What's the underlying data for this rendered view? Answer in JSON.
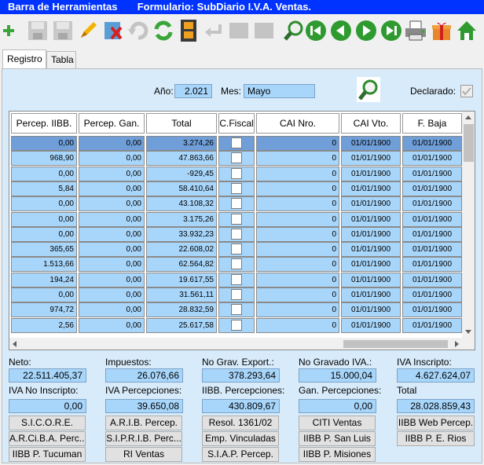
{
  "window": {
    "title": "Barra de Herramientas       Formulario: SubDiario I.V.A. Ventas."
  },
  "toolbar": {
    "icons": [
      "add-icon",
      "save-disabled-icon",
      "save-disabled-icon",
      "edit-icon",
      "delete-icon",
      "undo-disabled-icon",
      "refresh-icon",
      "film-icon",
      "return-disabled-icon",
      "disabled-icon",
      "disabled-icon",
      "search-icon",
      "first-icon",
      "previous-icon",
      "next-icon",
      "last-icon",
      "printer-icon",
      "gift-icon",
      "home-icon"
    ]
  },
  "tabs": [
    {
      "label": "Registro"
    },
    {
      "label": "Tabla"
    }
  ],
  "filter": {
    "anio_label": "Año:",
    "anio_value": "2.021",
    "mes_label": "Mes:",
    "mes_value": "Mayo",
    "declarado_label": "Declarado:"
  },
  "grid": {
    "columns": [
      "Percep. IIBB.",
      "Percep. Gan.",
      "Total",
      "C.Fiscal",
      "CAI Nro.",
      "CAI Vto.",
      "F. Baja"
    ],
    "rows": [
      {
        "iibb": "0,00",
        "gan": "0,00",
        "total": "3.274,26",
        "cai": "0",
        "vto": "01/01/1900",
        "baja": "01/01/1900"
      },
      {
        "iibb": "968,90",
        "gan": "0,00",
        "total": "47.863,66",
        "cai": "0",
        "vto": "01/01/1900",
        "baja": "01/01/1900"
      },
      {
        "iibb": "0,00",
        "gan": "0,00",
        "total": "-929,45",
        "cai": "0",
        "vto": "01/01/1900",
        "baja": "01/01/1900"
      },
      {
        "iibb": "5,84",
        "gan": "0,00",
        "total": "58.410,64",
        "cai": "0",
        "vto": "01/01/1900",
        "baja": "01/01/1900"
      },
      {
        "iibb": "0,00",
        "gan": "0,00",
        "total": "43.108,32",
        "cai": "0",
        "vto": "01/01/1900",
        "baja": "01/01/1900"
      },
      {
        "iibb": "0,00",
        "gan": "0,00",
        "total": "3.175,26",
        "cai": "0",
        "vto": "01/01/1900",
        "baja": "01/01/1900"
      },
      {
        "iibb": "0,00",
        "gan": "0,00",
        "total": "33.932,23",
        "cai": "0",
        "vto": "01/01/1900",
        "baja": "01/01/1900"
      },
      {
        "iibb": "365,65",
        "gan": "0,00",
        "total": "22.608,02",
        "cai": "0",
        "vto": "01/01/1900",
        "baja": "01/01/1900"
      },
      {
        "iibb": "1.513,66",
        "gan": "0,00",
        "total": "62.564,82",
        "cai": "0",
        "vto": "01/01/1900",
        "baja": "01/01/1900"
      },
      {
        "iibb": "194,24",
        "gan": "0,00",
        "total": "19.617,55",
        "cai": "0",
        "vto": "01/01/1900",
        "baja": "01/01/1900"
      },
      {
        "iibb": "0,00",
        "gan": "0,00",
        "total": "31.561,11",
        "cai": "0",
        "vto": "01/01/1900",
        "baja": "01/01/1900"
      },
      {
        "iibb": "974,72",
        "gan": "0,00",
        "total": "28.832,59",
        "cai": "0",
        "vto": "01/01/1900",
        "baja": "01/01/1900"
      },
      {
        "iibb": "2,56",
        "gan": "0,00",
        "total": "25.617,58",
        "cai": "0",
        "vto": "01/01/1900",
        "baja": "01/01/1900"
      }
    ]
  },
  "totals": {
    "neto": {
      "label": "Neto:",
      "value": "22.511.405,37"
    },
    "impuestos": {
      "label": "Impuestos:",
      "value": "26.076,66"
    },
    "no_grav_export": {
      "label": "No Grav. Export.:",
      "value": "378.293,64"
    },
    "no_gravado_iva": {
      "label": "No Gravado IVA.:",
      "value": "15.000,04"
    },
    "iva_inscripto": {
      "label": "IVA Inscripto:",
      "value": "4.627.624,07"
    },
    "iva_no_inscripto": {
      "label": "IVA No Inscripto:",
      "value": "0,00"
    },
    "iva_percepciones": {
      "label": "IVA Percepciones:",
      "value": "39.650,08"
    },
    "iibb_percepciones": {
      "label": "IIBB. Percepciones:",
      "value": "430.809,67"
    },
    "gan_percepciones": {
      "label": "Gan. Percepciones:",
      "value": "0,00"
    },
    "total": {
      "label": "Total",
      "value": "28.028.859,43"
    }
  },
  "buttons": {
    "sicore": "S.I.C.O.R.E.",
    "arib": "A.R.I.B. Percep.",
    "resol": "Resol. 1361/02",
    "citi": "CITI Ventas",
    "iibb_web": "IIBB Web Percep.",
    "arciba": "A.R.Ci.B.A. Perc...",
    "siprib": "S.I.P.R.I.B. Perc...",
    "emp": "Emp. Vinculadas",
    "iibb_sanluis": "IIBB P. San Luis",
    "iibb_rios": "IIBB P. E. Rios",
    "iibb_tucuman": "IIBB P. Tucuman",
    "ri_ventas": "RI Ventas",
    "siap": "S.I.A.P. Percep.",
    "iibb_misiones": "IIBB P. Misiones"
  },
  "colors": {
    "title_bar": "#0033ff",
    "field": "#a8d6fb",
    "selected_row": "#6f9ed8",
    "panel": "#d8ebfa"
  }
}
